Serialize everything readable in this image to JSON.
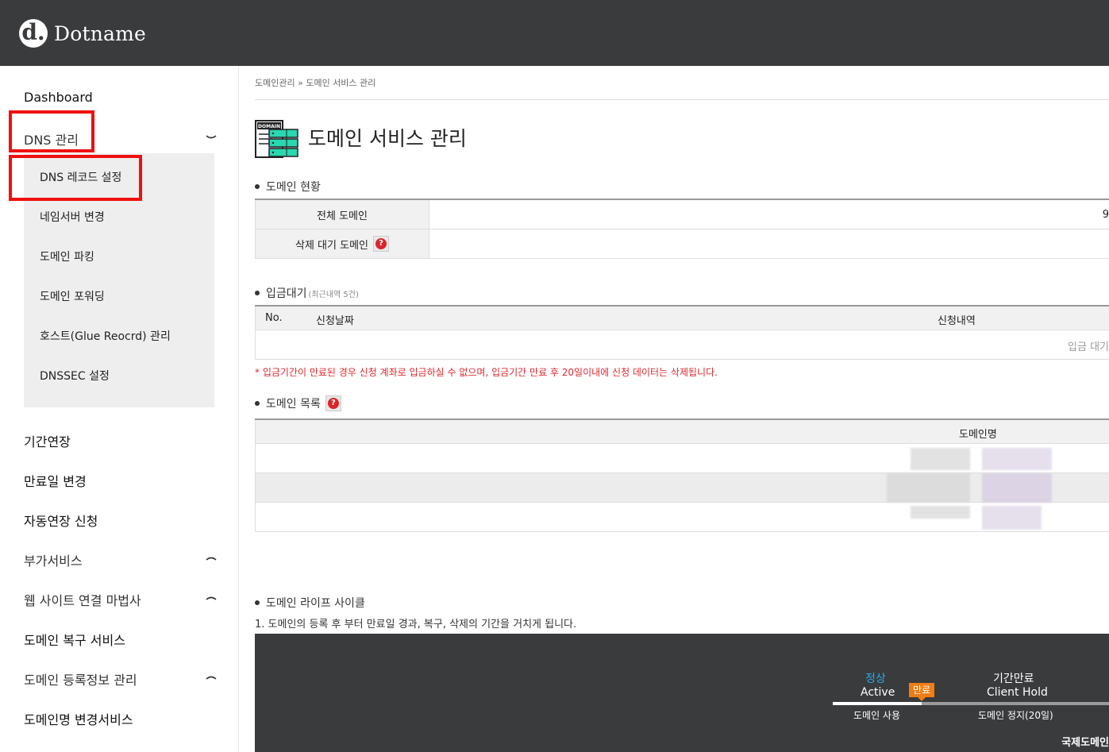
{
  "brand": {
    "logo_letter": "d.",
    "name": "Dotname"
  },
  "sidebar": {
    "dashboard": "Dashboard",
    "dns_group": "DNS 관리",
    "dns_items": [
      "DNS 레코드 설정",
      "네임서버 변경",
      "도메인 파킹",
      "도메인 포워딩",
      "호스트(Glue Reocrd) 관리",
      "DNSSEC 설정"
    ],
    "items": [
      "기간연장",
      "만료일 변경",
      "자동연장 신청",
      "부가서비스",
      "웹 사이트 연결 마법사",
      "도메인 복구 서비스",
      "도메인 등록정보 관리",
      "도메인명 변경서비스"
    ]
  },
  "breadcrumb": "도메인관리 » 도메인 서비스 관리",
  "page": {
    "title": "도메인 서비스 관리",
    "icon_label": "DOMAIN"
  },
  "status_section": {
    "title": "도메인 현황",
    "rows": [
      {
        "label": "전체 도메인",
        "value": "9"
      },
      {
        "label": "삭제 대기 도메인",
        "value": ""
      }
    ]
  },
  "pending_section": {
    "title": "입금대기",
    "note": "(최근내역 5건)",
    "columns": [
      "No.",
      "신청날짜",
      "신청내역"
    ],
    "empty_text": "입금 대기"
  },
  "notice": "* 입금기간이 만료된 경우 신청 계좌로 입금하실 수 없으며, 입금기간 만료 후 20일이내에 신청 데이터는 삭제됩니다.",
  "domain_list": {
    "title": "도메인 목록",
    "column": "도메인명"
  },
  "lifecycle": {
    "title": "도메인 라이프 사이클",
    "description": "1. 도메인의 등록 후 부터 만료일 경과, 복구, 삭제의 기간을 거치게 됩니다.",
    "active_ko": "정상",
    "active_en": "Active",
    "expire_badge": "만료",
    "hold_ko": "기간만료",
    "hold_en": "Client Hold",
    "active_sub": "도메인 사용",
    "hold_sub": "도메인 정지(20일)",
    "corner_label": "국제도메인"
  },
  "colors": {
    "header_bg": "#3a3b3d",
    "highlight": "#f01010",
    "notice": "#e0282e",
    "active_accent": "#29a8e8",
    "badge": "#ef7d16"
  }
}
